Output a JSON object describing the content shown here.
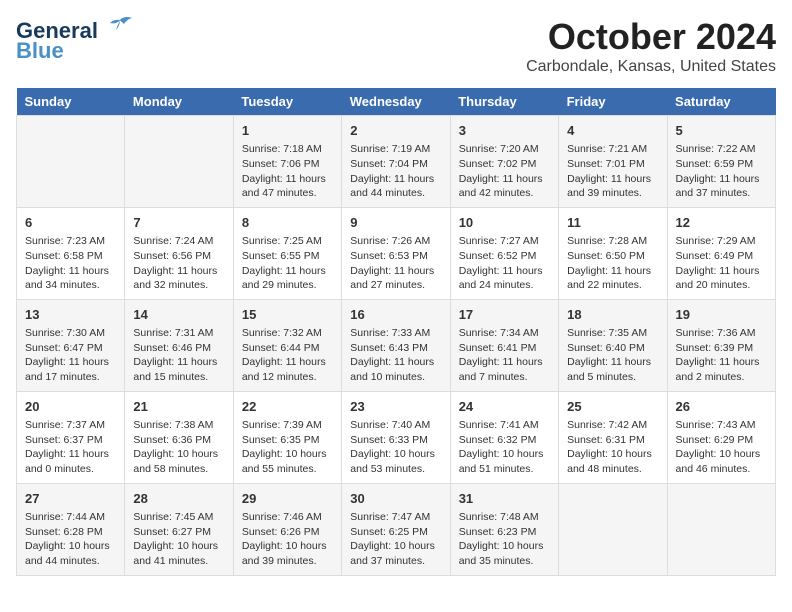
{
  "header": {
    "logo_line1": "General",
    "logo_line2": "Blue",
    "title": "October 2024",
    "subtitle": "Carbondale, Kansas, United States"
  },
  "days_of_week": [
    "Sunday",
    "Monday",
    "Tuesday",
    "Wednesday",
    "Thursday",
    "Friday",
    "Saturday"
  ],
  "weeks": [
    [
      {
        "day": "",
        "info": ""
      },
      {
        "day": "",
        "info": ""
      },
      {
        "day": "1",
        "info": "Sunrise: 7:18 AM\nSunset: 7:06 PM\nDaylight: 11 hours and 47 minutes."
      },
      {
        "day": "2",
        "info": "Sunrise: 7:19 AM\nSunset: 7:04 PM\nDaylight: 11 hours and 44 minutes."
      },
      {
        "day": "3",
        "info": "Sunrise: 7:20 AM\nSunset: 7:02 PM\nDaylight: 11 hours and 42 minutes."
      },
      {
        "day": "4",
        "info": "Sunrise: 7:21 AM\nSunset: 7:01 PM\nDaylight: 11 hours and 39 minutes."
      },
      {
        "day": "5",
        "info": "Sunrise: 7:22 AM\nSunset: 6:59 PM\nDaylight: 11 hours and 37 minutes."
      }
    ],
    [
      {
        "day": "6",
        "info": "Sunrise: 7:23 AM\nSunset: 6:58 PM\nDaylight: 11 hours and 34 minutes."
      },
      {
        "day": "7",
        "info": "Sunrise: 7:24 AM\nSunset: 6:56 PM\nDaylight: 11 hours and 32 minutes."
      },
      {
        "day": "8",
        "info": "Sunrise: 7:25 AM\nSunset: 6:55 PM\nDaylight: 11 hours and 29 minutes."
      },
      {
        "day": "9",
        "info": "Sunrise: 7:26 AM\nSunset: 6:53 PM\nDaylight: 11 hours and 27 minutes."
      },
      {
        "day": "10",
        "info": "Sunrise: 7:27 AM\nSunset: 6:52 PM\nDaylight: 11 hours and 24 minutes."
      },
      {
        "day": "11",
        "info": "Sunrise: 7:28 AM\nSunset: 6:50 PM\nDaylight: 11 hours and 22 minutes."
      },
      {
        "day": "12",
        "info": "Sunrise: 7:29 AM\nSunset: 6:49 PM\nDaylight: 11 hours and 20 minutes."
      }
    ],
    [
      {
        "day": "13",
        "info": "Sunrise: 7:30 AM\nSunset: 6:47 PM\nDaylight: 11 hours and 17 minutes."
      },
      {
        "day": "14",
        "info": "Sunrise: 7:31 AM\nSunset: 6:46 PM\nDaylight: 11 hours and 15 minutes."
      },
      {
        "day": "15",
        "info": "Sunrise: 7:32 AM\nSunset: 6:44 PM\nDaylight: 11 hours and 12 minutes."
      },
      {
        "day": "16",
        "info": "Sunrise: 7:33 AM\nSunset: 6:43 PM\nDaylight: 11 hours and 10 minutes."
      },
      {
        "day": "17",
        "info": "Sunrise: 7:34 AM\nSunset: 6:41 PM\nDaylight: 11 hours and 7 minutes."
      },
      {
        "day": "18",
        "info": "Sunrise: 7:35 AM\nSunset: 6:40 PM\nDaylight: 11 hours and 5 minutes."
      },
      {
        "day": "19",
        "info": "Sunrise: 7:36 AM\nSunset: 6:39 PM\nDaylight: 11 hours and 2 minutes."
      }
    ],
    [
      {
        "day": "20",
        "info": "Sunrise: 7:37 AM\nSunset: 6:37 PM\nDaylight: 11 hours and 0 minutes."
      },
      {
        "day": "21",
        "info": "Sunrise: 7:38 AM\nSunset: 6:36 PM\nDaylight: 10 hours and 58 minutes."
      },
      {
        "day": "22",
        "info": "Sunrise: 7:39 AM\nSunset: 6:35 PM\nDaylight: 10 hours and 55 minutes."
      },
      {
        "day": "23",
        "info": "Sunrise: 7:40 AM\nSunset: 6:33 PM\nDaylight: 10 hours and 53 minutes."
      },
      {
        "day": "24",
        "info": "Sunrise: 7:41 AM\nSunset: 6:32 PM\nDaylight: 10 hours and 51 minutes."
      },
      {
        "day": "25",
        "info": "Sunrise: 7:42 AM\nSunset: 6:31 PM\nDaylight: 10 hours and 48 minutes."
      },
      {
        "day": "26",
        "info": "Sunrise: 7:43 AM\nSunset: 6:29 PM\nDaylight: 10 hours and 46 minutes."
      }
    ],
    [
      {
        "day": "27",
        "info": "Sunrise: 7:44 AM\nSunset: 6:28 PM\nDaylight: 10 hours and 44 minutes."
      },
      {
        "day": "28",
        "info": "Sunrise: 7:45 AM\nSunset: 6:27 PM\nDaylight: 10 hours and 41 minutes."
      },
      {
        "day": "29",
        "info": "Sunrise: 7:46 AM\nSunset: 6:26 PM\nDaylight: 10 hours and 39 minutes."
      },
      {
        "day": "30",
        "info": "Sunrise: 7:47 AM\nSunset: 6:25 PM\nDaylight: 10 hours and 37 minutes."
      },
      {
        "day": "31",
        "info": "Sunrise: 7:48 AM\nSunset: 6:23 PM\nDaylight: 10 hours and 35 minutes."
      },
      {
        "day": "",
        "info": ""
      },
      {
        "day": "",
        "info": ""
      }
    ]
  ]
}
